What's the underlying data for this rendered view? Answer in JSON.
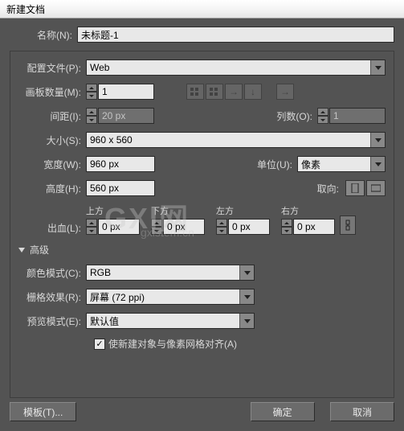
{
  "window": {
    "title": "新建文档"
  },
  "name": {
    "label": "名称(N):",
    "value": "未标题-1"
  },
  "profile": {
    "label": "配置文件(P):",
    "value": "Web"
  },
  "artboards": {
    "label": "画板数量(M):",
    "value": "1"
  },
  "spacing": {
    "label": "间距(I):",
    "value": "20 px"
  },
  "columns": {
    "label": "列数(O):",
    "value": "1"
  },
  "size": {
    "label": "大小(S):",
    "value": "960 x 560"
  },
  "width": {
    "label": "宽度(W):",
    "value": "960 px"
  },
  "unitLabel": "单位(U):",
  "unitValue": "像素",
  "height": {
    "label": "高度(H):",
    "value": "560 px"
  },
  "orientLabel": "取向:",
  "bleed": {
    "label": "出血(L):",
    "top": {
      "label": "上方",
      "value": "0 px"
    },
    "bottom": {
      "label": "下方",
      "value": "0 px"
    },
    "left": {
      "label": "左方",
      "value": "0 px"
    },
    "right": {
      "label": "右方",
      "value": "0 px"
    }
  },
  "advanced": "高级",
  "colorMode": {
    "label": "颜色模式(C):",
    "value": "RGB"
  },
  "raster": {
    "label": "栅格效果(R):",
    "value": "屏幕 (72 ppi)"
  },
  "preview": {
    "label": "预览模式(E):",
    "value": "默认值"
  },
  "alignGrid": "使新建对象与像素网格对齐(A)",
  "buttons": {
    "template": "模板(T)...",
    "ok": "确定",
    "cancel": "取消"
  },
  "watermark": {
    "l1": "GXI网",
    "l2": "gxlstem.cn"
  }
}
